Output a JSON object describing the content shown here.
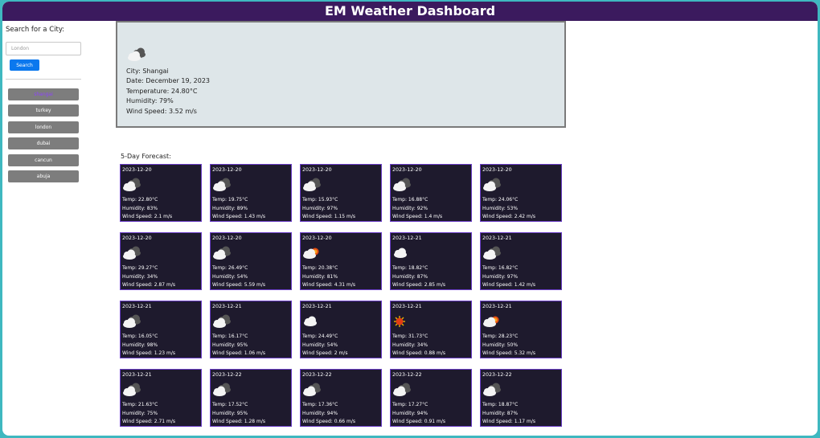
{
  "header": {
    "title": "EM Weather Dashboard"
  },
  "sidebar": {
    "search_label": "Search for a City:",
    "search_placeholder": "London",
    "search_button": "Search",
    "cities": [
      "shangai",
      "turkey",
      "london",
      "dubai",
      "cancun",
      "abuja"
    ],
    "active_city": "shangai"
  },
  "current": {
    "icon": "cloudy-icon",
    "city": "City: Shangai",
    "date": "Date: December 19, 2023",
    "temperature": "Temperature: 24.80°C",
    "humidity": "Humidity: 79%",
    "wind": "Wind Speed: 3.52 m/s"
  },
  "forecast_title": "5-Day Forecast:",
  "forecast": [
    {
      "date": "2023-12-20",
      "icon": "cloudy-icon",
      "temp": "Temp: 22.80°C",
      "humidity": "Humidity: 83%",
      "wind": "Wind Speed: 2.1 m/s"
    },
    {
      "date": "2023-12-20",
      "icon": "cloudy-icon",
      "temp": "Temp: 19.75°C",
      "humidity": "Humidity: 89%",
      "wind": "Wind Speed: 1.43 m/s"
    },
    {
      "date": "2023-12-20",
      "icon": "cloudy-icon",
      "temp": "Temp: 15.93°C",
      "humidity": "Humidity: 97%",
      "wind": "Wind Speed: 1.15 m/s"
    },
    {
      "date": "2023-12-20",
      "icon": "cloudy-icon",
      "temp": "Temp: 16.88°C",
      "humidity": "Humidity: 92%",
      "wind": "Wind Speed: 1.4 m/s"
    },
    {
      "date": "2023-12-20",
      "icon": "cloudy-icon",
      "temp": "Temp: 24.06°C",
      "humidity": "Humidity: 53%",
      "wind": "Wind Speed: 2.42 m/s"
    },
    {
      "date": "2023-12-20",
      "icon": "cloudy-icon",
      "temp": "Temp: 29.27°C",
      "humidity": "Humidity: 34%",
      "wind": "Wind Speed: 2.87 m/s"
    },
    {
      "date": "2023-12-20",
      "icon": "cloudy-icon",
      "temp": "Temp: 26.49°C",
      "humidity": "Humidity: 54%",
      "wind": "Wind Speed: 5.59 m/s"
    },
    {
      "date": "2023-12-20",
      "icon": "partly-sunny-icon",
      "temp": "Temp: 20.38°C",
      "humidity": "Humidity: 81%",
      "wind": "Wind Speed: 4.31 m/s"
    },
    {
      "date": "2023-12-21",
      "icon": "cloud-icon",
      "temp": "Temp: 18.82°C",
      "humidity": "Humidity: 87%",
      "wind": "Wind Speed: 2.85 m/s"
    },
    {
      "date": "2023-12-21",
      "icon": "cloudy-icon",
      "temp": "Temp: 16.82°C",
      "humidity": "Humidity: 97%",
      "wind": "Wind Speed: 1.42 m/s"
    },
    {
      "date": "2023-12-21",
      "icon": "cloudy-icon",
      "temp": "Temp: 16.05°C",
      "humidity": "Humidity: 98%",
      "wind": "Wind Speed: 1.23 m/s"
    },
    {
      "date": "2023-12-21",
      "icon": "cloudy-icon",
      "temp": "Temp: 16.17°C",
      "humidity": "Humidity: 95%",
      "wind": "Wind Speed: 1.06 m/s"
    },
    {
      "date": "2023-12-21",
      "icon": "cloud-icon",
      "temp": "Temp: 24.49°C",
      "humidity": "Humidity: 54%",
      "wind": "Wind Speed: 2 m/s"
    },
    {
      "date": "2023-12-21",
      "icon": "sun-icon",
      "temp": "Temp: 31.73°C",
      "humidity": "Humidity: 34%",
      "wind": "Wind Speed: 0.88 m/s"
    },
    {
      "date": "2023-12-21",
      "icon": "partly-sunny-icon",
      "temp": "Temp: 28.23°C",
      "humidity": "Humidity: 50%",
      "wind": "Wind Speed: 5.32 m/s"
    },
    {
      "date": "2023-12-21",
      "icon": "cloudy-icon",
      "temp": "Temp: 21.63°C",
      "humidity": "Humidity: 75%",
      "wind": "Wind Speed: 2.71 m/s"
    },
    {
      "date": "2023-12-22",
      "icon": "cloudy-icon",
      "temp": "Temp: 17.52°C",
      "humidity": "Humidity: 95%",
      "wind": "Wind Speed: 1.28 m/s"
    },
    {
      "date": "2023-12-22",
      "icon": "cloudy-icon",
      "temp": "Temp: 17.36°C",
      "humidity": "Humidity: 94%",
      "wind": "Wind Speed: 0.66 m/s"
    },
    {
      "date": "2023-12-22",
      "icon": "cloudy-icon",
      "temp": "Temp: 17.27°C",
      "humidity": "Humidity: 94%",
      "wind": "Wind Speed: 0.91 m/s"
    },
    {
      "date": "2023-12-22",
      "icon": "cloudy-icon",
      "temp": "Temp: 18.87°C",
      "humidity": "Humidity: 87%",
      "wind": "Wind Speed: 1.17 m/s"
    }
  ]
}
